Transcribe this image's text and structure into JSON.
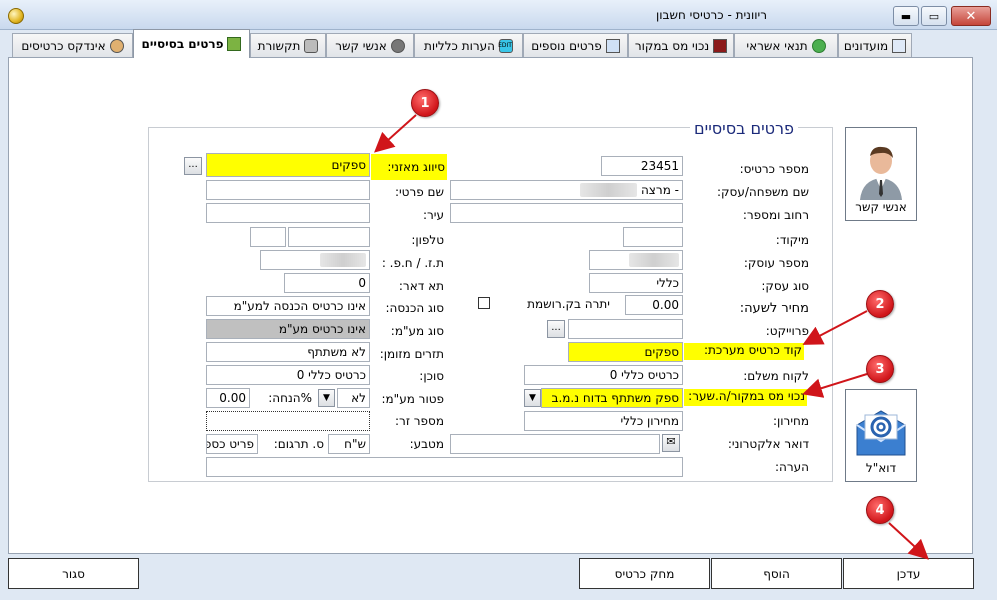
{
  "window": {
    "title": "ריוונית - כרטיסי חשבון",
    "close_glyph": "✕",
    "max_glyph": "▭",
    "min_glyph": "▬"
  },
  "tabs": [
    {
      "label": "מועדונים",
      "icon": "monitor-icon"
    },
    {
      "label": "תנאי אשראי",
      "icon": "money-bag-icon"
    },
    {
      "label": "נכוי מס במקור",
      "icon": "stamp-icon"
    },
    {
      "label": "פרטים נוספים",
      "icon": "form-icon"
    },
    {
      "label": "הערות כלליות",
      "icon": "edit-icon",
      "icon_text": "EDIT"
    },
    {
      "label": "אנשי קשר",
      "icon": "contacts-icon"
    },
    {
      "label": "תקשורת",
      "icon": "phone-icon"
    },
    {
      "label": "פרטים בסיסיים",
      "icon": "book-icon",
      "active": true
    },
    {
      "label": "אינדקס כרטיסים",
      "icon": "dog-icon"
    }
  ],
  "section_title": "פרטים בסיסיים",
  "form": {
    "card_number": {
      "label": "מספר כרטיס:",
      "value": "23451"
    },
    "balance_class": {
      "label": "סיווג מאזני:",
      "value": "ספקים",
      "button": "..."
    },
    "last_name": {
      "label": "שם משפחה/עסק:",
      "value": "- מרצה"
    },
    "first_name": {
      "label": "שם פרטי:",
      "value": ""
    },
    "street": {
      "label": "רחוב ומספר:",
      "value": ""
    },
    "city": {
      "label": "עיר:",
      "value": ""
    },
    "zip": {
      "label": "מיקוד:",
      "value": ""
    },
    "phone": {
      "label": "טלפון:",
      "value": ""
    },
    "dealer_number": {
      "label": "מספר עוסק:",
      "value": ""
    },
    "id_number": {
      "label": "ת.ז. / ח.פ. :",
      "value": ""
    },
    "business_type": {
      "label": "סוג עסק:",
      "value": "כללי"
    },
    "po_box": {
      "label": "תא דאר:",
      "value": "0"
    },
    "hourly_price": {
      "label": "מחיר לשעה:",
      "value": "0.00"
    },
    "recorded_balance": {
      "label": "יתרה בק.רושמת"
    },
    "income_type": {
      "label": "סוג הכנסה:",
      "value": "אינו כרטיס הכנסה למע\"מ"
    },
    "project": {
      "label": "פרוייקט:",
      "value": "",
      "button": "..."
    },
    "vat_type": {
      "label": "סוג מע\"מ:",
      "value": "אינו כרטיס מע\"מ"
    },
    "system_code": {
      "label": "קוד כרטיס מערכת:",
      "value": "ספקים"
    },
    "scheduled_flows": {
      "label": "תזרים מזומן:",
      "value": "לא משתתף"
    },
    "paying_customer": {
      "label": "לקוח משלם:",
      "value": "כרטיס כללי 0"
    },
    "agent": {
      "label": "סוכן:",
      "value": "כרטיס כללי 0"
    },
    "withholding": {
      "label": "נכוי מס במקור/ה.שער:",
      "value": "ספק משתתף בדוח נ.מ.ב"
    },
    "vat_exempt": {
      "label": "פטור מע\"מ:",
      "value": "לא"
    },
    "discount": {
      "label": "%הנחה:",
      "value": "0.00"
    },
    "price_list": {
      "label": "מחירון:",
      "value": "מחירון כללי"
    },
    "foreign_number": {
      "label": "מספר זר:",
      "value": ""
    },
    "email": {
      "label": "דואר אלקטרוני:",
      "value": ""
    },
    "currency": {
      "label": "מטבע:",
      "value": "ש\"ח",
      "translation_label": "ס. תרגום:",
      "translation_value": "פריט כספי"
    },
    "notes": {
      "label": "הערה:",
      "value": ""
    }
  },
  "side_buttons": {
    "contacts": "אנשי קשר",
    "email": "דוא\"ל"
  },
  "bottom_buttons": {
    "update": "עדכן",
    "add": "הוסף",
    "delete": "מחק כרטיס",
    "close": "סגור"
  },
  "callouts": [
    "1",
    "2",
    "3",
    "4"
  ],
  "colors": {
    "highlight": "#ffff00",
    "callout": "#d0151a",
    "title_blue": "#1b2a7a"
  }
}
